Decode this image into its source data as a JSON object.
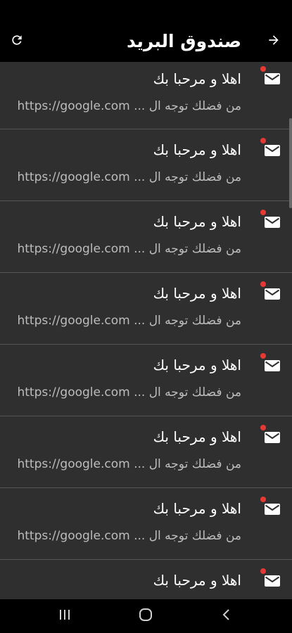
{
  "header": {
    "title": "صندوق البريد",
    "refresh_icon": "refresh-icon",
    "back_icon": "arrow-forward-icon"
  },
  "messages": [
    {
      "subject": "اهلا و مرحبا بك",
      "preview": "من فضلك توجه ال ... https://google.com",
      "unread": true
    },
    {
      "subject": "اهلا و مرحبا بك",
      "preview": "من فضلك توجه ال ... https://google.com",
      "unread": true
    },
    {
      "subject": "اهلا و مرحبا بك",
      "preview": "من فضلك توجه ال ... https://google.com",
      "unread": true
    },
    {
      "subject": "اهلا و مرحبا بك",
      "preview": "من فضلك توجه ال ... https://google.com",
      "unread": true
    },
    {
      "subject": "اهلا و مرحبا بك",
      "preview": "من فضلك توجه ال ... https://google.com",
      "unread": true
    },
    {
      "subject": "اهلا و مرحبا بك",
      "preview": "من فضلك توجه ال ... https://google.com",
      "unread": true
    },
    {
      "subject": "اهلا و مرحبا بك",
      "preview": "من فضلك توجه ال ... https://google.com",
      "unread": true
    },
    {
      "subject": "اهلا و مرحبا بك",
      "preview": "",
      "unread": true
    }
  ],
  "colors": {
    "background": "#000000",
    "list_background": "#2f2f2f",
    "divider": "#555555",
    "unread_dot": "#e53935",
    "preview_text": "#bdbdbd"
  },
  "navbar": {
    "recents_icon": "recents-icon",
    "home_icon": "home-icon",
    "back_icon": "back-icon"
  }
}
